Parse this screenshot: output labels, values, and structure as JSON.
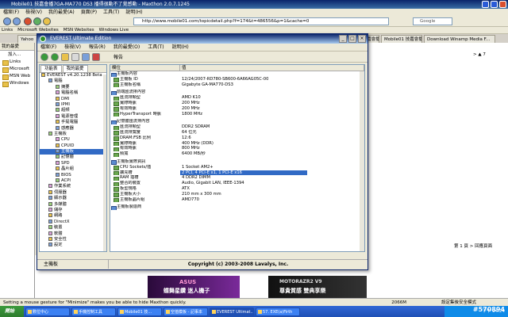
{
  "maxthon": {
    "title": "Mobile01 技嘉會播7GA-MA770 DS3 播得很動不了覺感動 - Maxthon 2.0.7.1245",
    "menu": [
      "檔案(F)",
      "檢視(V)",
      "我的最愛(A)",
      "頁面(P)",
      "工具(T)",
      "說明(H)"
    ],
    "address": "http://www.mobile01.com/topicdetail.php?f=174&t=486556&p=1&cache=0",
    "search_placeholder": "Google",
    "links": [
      "Links",
      "Microsoft Websites",
      "MSN Websites",
      "Windows Live"
    ],
    "tabs": [
      "Yahoo",
      "Mobile01 技嘉會播7GA...",
      "Mobile01 技嘉會播7GA...",
      "Download Winamp Media F..."
    ],
    "sidebar": {
      "header": "我的最愛",
      "add_label": "加入...",
      "items": [
        "Links",
        "Microsoft",
        "MSN Web",
        "Windows"
      ]
    },
    "status": "Setting a mouse gesture for \"Minimize\" makes you be able to hide Maxthon quickly.",
    "zoom": "2066M",
    "security": "設定集後安全模式",
    "right_text": [
      "> ▲ 7",
      "第 1 頁 > 回應頁面"
    ]
  },
  "everest": {
    "title": "EVEREST Ultimate Edition",
    "menu": [
      "檔案(F)",
      "檢視(V)",
      "報告(R)",
      "我的最愛(O)",
      "工具(T)",
      "說明(H)"
    ],
    "report_label": "報告",
    "tree_tabs": [
      "功能表",
      "我的最愛"
    ],
    "tree": [
      {
        "label": "EVEREST v4.20.1238 Beta",
        "indent": 0
      },
      {
        "label": "電腦",
        "indent": 1
      },
      {
        "label": "摘要",
        "indent": 2
      },
      {
        "label": "電腦名稱",
        "indent": 2
      },
      {
        "label": "DMI",
        "indent": 2
      },
      {
        "label": "IPMI",
        "indent": 2
      },
      {
        "label": "超頻",
        "indent": 2
      },
      {
        "label": "電源管理",
        "indent": 2
      },
      {
        "label": "手提電腦",
        "indent": 2
      },
      {
        "label": "感應器",
        "indent": 2
      },
      {
        "label": "主機板",
        "indent": 1
      },
      {
        "label": "CPU",
        "indent": 2
      },
      {
        "label": "CPUID",
        "indent": 2
      },
      {
        "label": "主機板",
        "indent": 2,
        "selected": true
      },
      {
        "label": "記憶體",
        "indent": 2
      },
      {
        "label": "SPD",
        "indent": 2
      },
      {
        "label": "晶片組",
        "indent": 2
      },
      {
        "label": "BIOS",
        "indent": 2
      },
      {
        "label": "ACPI",
        "indent": 2
      },
      {
        "label": "作業系統",
        "indent": 1
      },
      {
        "label": "伺服器",
        "indent": 1
      },
      {
        "label": "顯示器",
        "indent": 1
      },
      {
        "label": "多媒體",
        "indent": 1
      },
      {
        "label": "儲存",
        "indent": 1
      },
      {
        "label": "網路",
        "indent": 1
      },
      {
        "label": "DirectX",
        "indent": 1
      },
      {
        "label": "裝置",
        "indent": 1
      },
      {
        "label": "軟體",
        "indent": 1
      },
      {
        "label": "安全性",
        "indent": 1
      },
      {
        "label": "設定",
        "indent": 1
      }
    ],
    "columns": [
      "欄位",
      "值"
    ],
    "rows": [
      {
        "type": "section",
        "field": "主機板內容"
      },
      {
        "field": "主機板 ID",
        "value": "12/24/2007-RD780-SB600-6A66AG05C-00"
      },
      {
        "field": "主機板名稱",
        "value": "Gigabyte GA-MA770-DS3"
      },
      {
        "type": "blank"
      },
      {
        "type": "section",
        "field": "前端匯流排內容"
      },
      {
        "field": "匯流排類型",
        "value": "AMD K10"
      },
      {
        "field": "實際時脈",
        "value": "200 MHz"
      },
      {
        "field": "有效時脈",
        "value": "200 MHz"
      },
      {
        "field": "HyperTransport 時脈",
        "value": "1800 MHz"
      },
      {
        "type": "blank"
      },
      {
        "type": "section",
        "field": "記憶體匯流排內容"
      },
      {
        "field": "匯流排類型",
        "value": "DDR2 SDRAM"
      },
      {
        "field": "匯流排寬度",
        "value": "64 位元"
      },
      {
        "field": "DRAM:FSB 比例",
        "value": "12:6"
      },
      {
        "field": "實際時脈",
        "value": "400 MHz (DDR)"
      },
      {
        "field": "有效時脈",
        "value": "800 MHz"
      },
      {
        "field": "頻寬",
        "value": "6400 MB/秒"
      },
      {
        "type": "blank"
      },
      {
        "type": "section",
        "field": "主機板實際資訊"
      },
      {
        "field": "CPU Sockets/插",
        "value": "1 Socket AM2+"
      },
      {
        "field": "擴充槽",
        "value": "2 PCI, 4 PCI-E x1, 1 PCI-E x16",
        "selected": true
      },
      {
        "field": "RAM 插槽",
        "value": "4 DDR2 DIMM"
      },
      {
        "field": "整合的裝置",
        "value": "Audio, Gigabit LAN, IEEE-1394"
      },
      {
        "field": "板型規格",
        "value": "ATX"
      },
      {
        "field": "主機板大小",
        "value": "210 mm x 300 mm"
      },
      {
        "field": "主機板晶片組",
        "value": "AMD770"
      },
      {
        "type": "blank"
      },
      {
        "type": "section",
        "field": "主機板製造商"
      }
    ],
    "status_left": "主機板",
    "status_right": "Copyright (c) 2003-2008 Lavalys, Inc."
  },
  "taskbar": {
    "start": "開始",
    "tasks": [
      "數位中心",
      "手機控制工具",
      "Mobile01 技...",
      "空值模板 - 記事本",
      "EVEREST Ultimat...",
      "57. EXE(a)Firth"
    ],
    "clock": "下午 04:24",
    "watermark": "#570894"
  },
  "banners": {
    "left_title": "ASUS",
    "left_text": "蝶舞星鑽 迷人機子",
    "right_title": "MOTORAZR2 V9",
    "right_text": "尊貴質感 雙典享樂"
  }
}
